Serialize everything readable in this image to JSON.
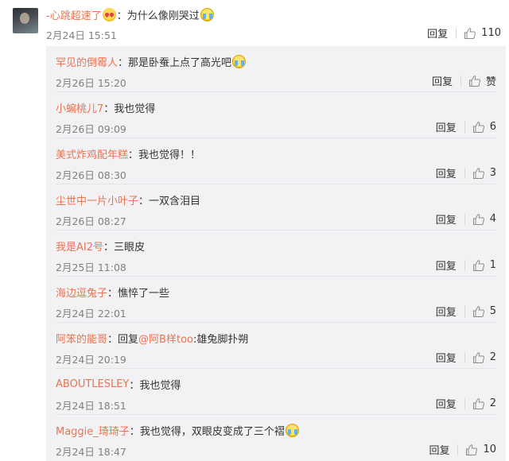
{
  "top_comment": {
    "username": "-心跳超速了",
    "emoji1": "heart-eyes-emoji",
    "colon": "：",
    "text": "为什么像刚哭过",
    "emoji2": "cry-emoji",
    "time": "2月24日 15:51",
    "reply_label": "回复",
    "like_count": "110"
  },
  "replies": [
    {
      "username": "罕见的倒霉人",
      "colon": "：",
      "text": "那是卧蚕上点了高光吧",
      "emoji": true,
      "time": "2月26日 15:20",
      "reply_label": "回复",
      "like": "赞"
    },
    {
      "username": "小蝙桃儿7",
      "colon": "：",
      "text": "我也觉得",
      "time": "2月26日 09:09",
      "reply_label": "回复",
      "like": "6"
    },
    {
      "username": "美式炸鸡配年糕",
      "colon": "：",
      "text": "我也觉得！！",
      "time": "2月26日 08:30",
      "reply_label": "回复",
      "like": "3"
    },
    {
      "username": "尘世中一片小叶子",
      "colon": "：",
      "text": "一双含泪目",
      "time": "2月26日 08:27",
      "reply_label": "回复",
      "like": "4"
    },
    {
      "username": "我是AI2号",
      "colon": "：",
      "text": "三眼皮",
      "time": "2月25日 11:08",
      "reply_label": "回复",
      "like": "1"
    },
    {
      "username": "海边逗兔子",
      "colon": "：",
      "text": "憔悴了一些",
      "time": "2月24日 22:01",
      "reply_label": "回复",
      "like": "5"
    },
    {
      "username": "阿笨的能哥",
      "colon": "：",
      "pre": "回复",
      "mention": "@阿B样too",
      "text": ":雄兔脚扑朔",
      "time": "2月24日 20:19",
      "reply_label": "回复",
      "like": "2"
    },
    {
      "username": "ABOUTLESLEY",
      "colon": "：",
      "text": "我也觉得",
      "time": "2月24日 18:51",
      "reply_label": "回复",
      "like": "2"
    },
    {
      "username": "Maggie_琦琦子",
      "colon": "：",
      "text": "我也觉得，双眼皮变成了三个褶",
      "emoji": true,
      "time": "2月24日 18:47",
      "reply_label": "回复",
      "like": "10"
    }
  ]
}
